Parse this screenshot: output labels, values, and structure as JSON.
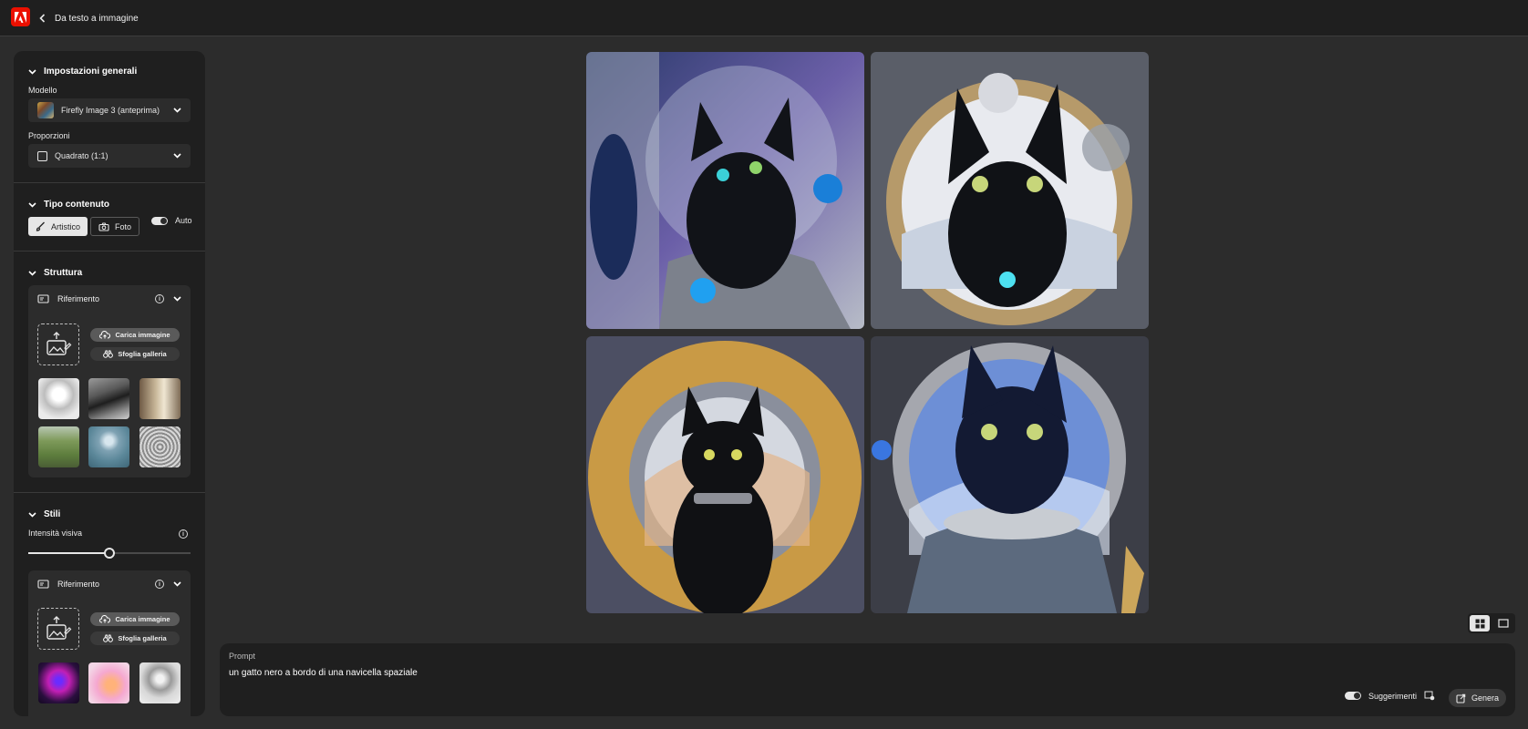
{
  "topbar": {
    "logo_icon": "adobe-logo",
    "back_label": "Da testo a immagine"
  },
  "sidebar": {
    "general": {
      "title": "Impostazioni generali",
      "model_label": "Modello",
      "model_value": "Firefly Image 3 (anteprima)",
      "aspect_label": "Proporzioni",
      "aspect_value": "Quadrato (1:1)"
    },
    "content_type": {
      "title": "Tipo contenuto",
      "art_label": "Artistico",
      "photo_label": "Foto",
      "auto_label": "Auto",
      "selected": "Artistico",
      "auto_on": true
    },
    "structure": {
      "title": "Struttura",
      "reference_label": "Riferimento",
      "upload_label": "Carica immagine",
      "browse_label": "Sfoglia galleria",
      "thumbs": [
        "sketch-bird",
        "mountain-road",
        "interior-room",
        "green-road",
        "sphere-scene",
        "owl-sketch"
      ]
    },
    "styles": {
      "title": "Stili",
      "intensity_label": "Intensità visiva",
      "intensity_value": 0.5,
      "reference_label": "Riferimento",
      "upload_label": "Carica immagine",
      "browse_label": "Sfoglia galleria",
      "thumbs": [
        "neon-figure",
        "thumbs-up-3d",
        "marble-bust"
      ]
    }
  },
  "gallery": {
    "images": [
      "cat-astronaut-helmet",
      "cat-porthole-moon",
      "cat-golden-porthole",
      "cat-blue-spacesuit"
    ],
    "view_mode": "grid"
  },
  "prompt": {
    "label": "Prompt",
    "text": "un gatto nero a bordo di una navicella spaziale",
    "suggestions_label": "Suggerimenti",
    "suggestions_on": true,
    "generate_label": "Genera"
  },
  "colors": {
    "accent": "#eb1000",
    "panel": "#1f1f1f",
    "background": "#2c2c2c"
  }
}
